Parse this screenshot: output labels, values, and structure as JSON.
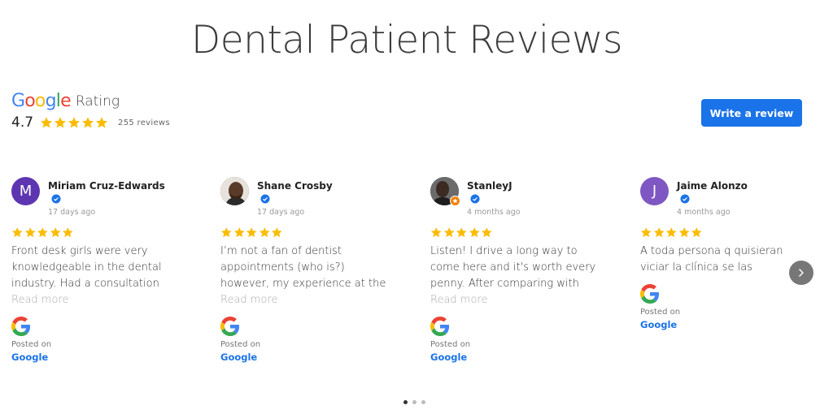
{
  "page": {
    "title": "Dental Patient Reviews"
  },
  "rating": {
    "provider": "Google",
    "label": "Rating",
    "score": "4.7",
    "count_text": "255 reviews",
    "stars": 5
  },
  "write_review_label": "Write a review",
  "colors": {
    "accent": "#1a73e8",
    "star": "#fbbc04",
    "google_blue": "#4285F4",
    "google_red": "#EA4335",
    "google_yellow": "#FBBC05",
    "google_green": "#34A853"
  },
  "reviews": [
    {
      "author": "Miriam Cruz-Edwards",
      "initial": "M",
      "avatar_color": "#5e35b1",
      "date": "17 days ago",
      "rating": 5,
      "text": "Front desk girls were very knowledgeable in the dental industry. Had a consultation and",
      "read_more": "Read more",
      "posted_on": "Posted on",
      "posted_source": "Google"
    },
    {
      "author": "Shane Crosby",
      "initial": "",
      "avatar_color": "#4a3428",
      "date": "17 days ago",
      "rating": 5,
      "text": "I’m not a fan of dentist appointments (who is?) however, my experience at the LA Dental",
      "read_more": "Read more",
      "posted_on": "Posted on",
      "posted_source": "Google"
    },
    {
      "author": "StanleyJ",
      "initial": "",
      "avatar_color": "#3d3d3d",
      "date": "4 months ago",
      "rating": 5,
      "text": "Listen! I drive a long way to come here and it's worth every penny. After comparing with multiple",
      "read_more": "Read more",
      "posted_on": "Posted on",
      "posted_source": "Google"
    },
    {
      "author": "Jaime Alonzo",
      "initial": "J",
      "avatar_color": "#7e57c2",
      "date": "4 months ago",
      "rating": 5,
      "text": "A toda persona q quisieran viciar la clínica se las recomiendo",
      "read_more": "",
      "posted_on": "Posted on",
      "posted_source": "Google"
    }
  ],
  "carousel": {
    "pages": 3,
    "active_page": 1
  }
}
